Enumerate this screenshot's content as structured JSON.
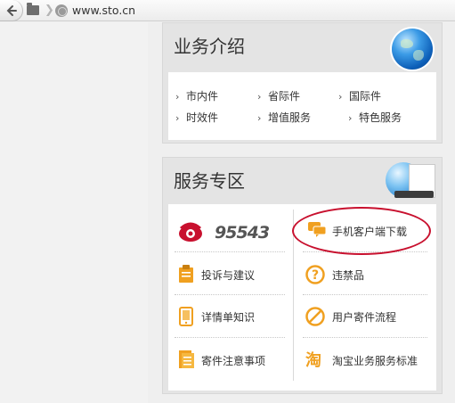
{
  "browser": {
    "url": "www.sto.cn"
  },
  "biz_panel": {
    "title": "业务介绍",
    "links": [
      "市内件",
      "省际件",
      "国际件",
      "时效件",
      "增值服务",
      "特色服务"
    ]
  },
  "svc_panel": {
    "title": "服务专区",
    "hotline": "95543",
    "items": {
      "app_download": "手机客户端下载",
      "complaint": "投诉与建议",
      "prohibited": "违禁品",
      "detail": "详情单知识",
      "process": "用户寄件流程",
      "notice": "寄件注意事项",
      "taobao": "淘宝业务服务标准"
    }
  },
  "colors": {
    "accent_orange": "#f0a020",
    "phone_red": "#c8102e",
    "ellipse_red": "#c8102e"
  }
}
